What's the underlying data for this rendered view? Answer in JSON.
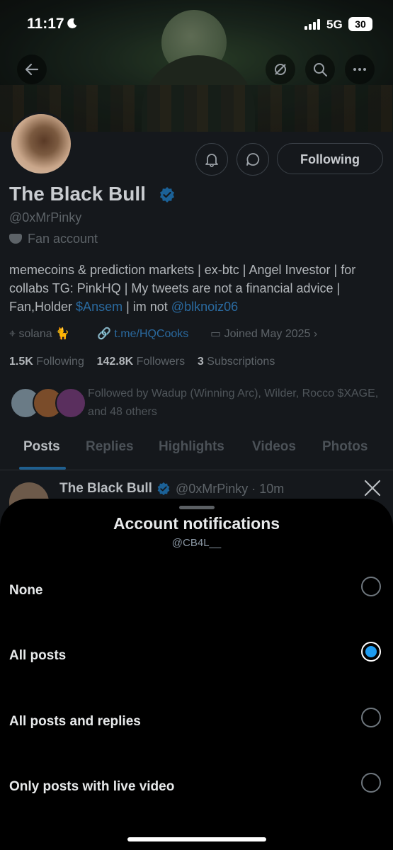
{
  "status_bar": {
    "time": "11:17",
    "network": "5G",
    "battery": "30"
  },
  "profile": {
    "name": "The Black Bull",
    "handle": "@0xMrPinky",
    "category": "Fan account",
    "follow_button": "Following",
    "bio_prefix": "memecoins & prediction markets | ex-btc | Angel Investor | for collabs TG: PinkHQ | My tweets are not a financial advice | Fan,Holder ",
    "bio_link1": "$Ansem",
    "bio_middle": " | im not ",
    "bio_link2": "@blknoiz06",
    "location": "solana 🐈",
    "website": "t.me/HQCooks",
    "joined": "Joined May 2025",
    "stats": {
      "following_count": "1.5K",
      "following_label": "Following",
      "followers_count": "142.8K",
      "followers_label": "Followers",
      "subs_count": "3",
      "subs_label": "Subscriptions"
    },
    "followed_by": "Followed by Wadup (Winning Arc), Wilder, Rocco $XAGE, and 48 others",
    "tabs": [
      "Posts",
      "Replies",
      "Highlights",
      "Videos",
      "Photos"
    ]
  },
  "post": {
    "author": "The Black Bull",
    "handle_time": "@0xMrPinky · 10m"
  },
  "sheet": {
    "title": "Account notifications",
    "subtitle": "@CB4L__",
    "options": [
      {
        "label": "None",
        "selected": false
      },
      {
        "label": "All posts",
        "selected": true
      },
      {
        "label": "All posts and replies",
        "selected": false
      },
      {
        "label": "Only posts with live video",
        "selected": false
      }
    ]
  },
  "colors": {
    "accent": "#1d9bf0",
    "sheet_bg": "#000000",
    "dimmed_bg": "#15181c"
  }
}
